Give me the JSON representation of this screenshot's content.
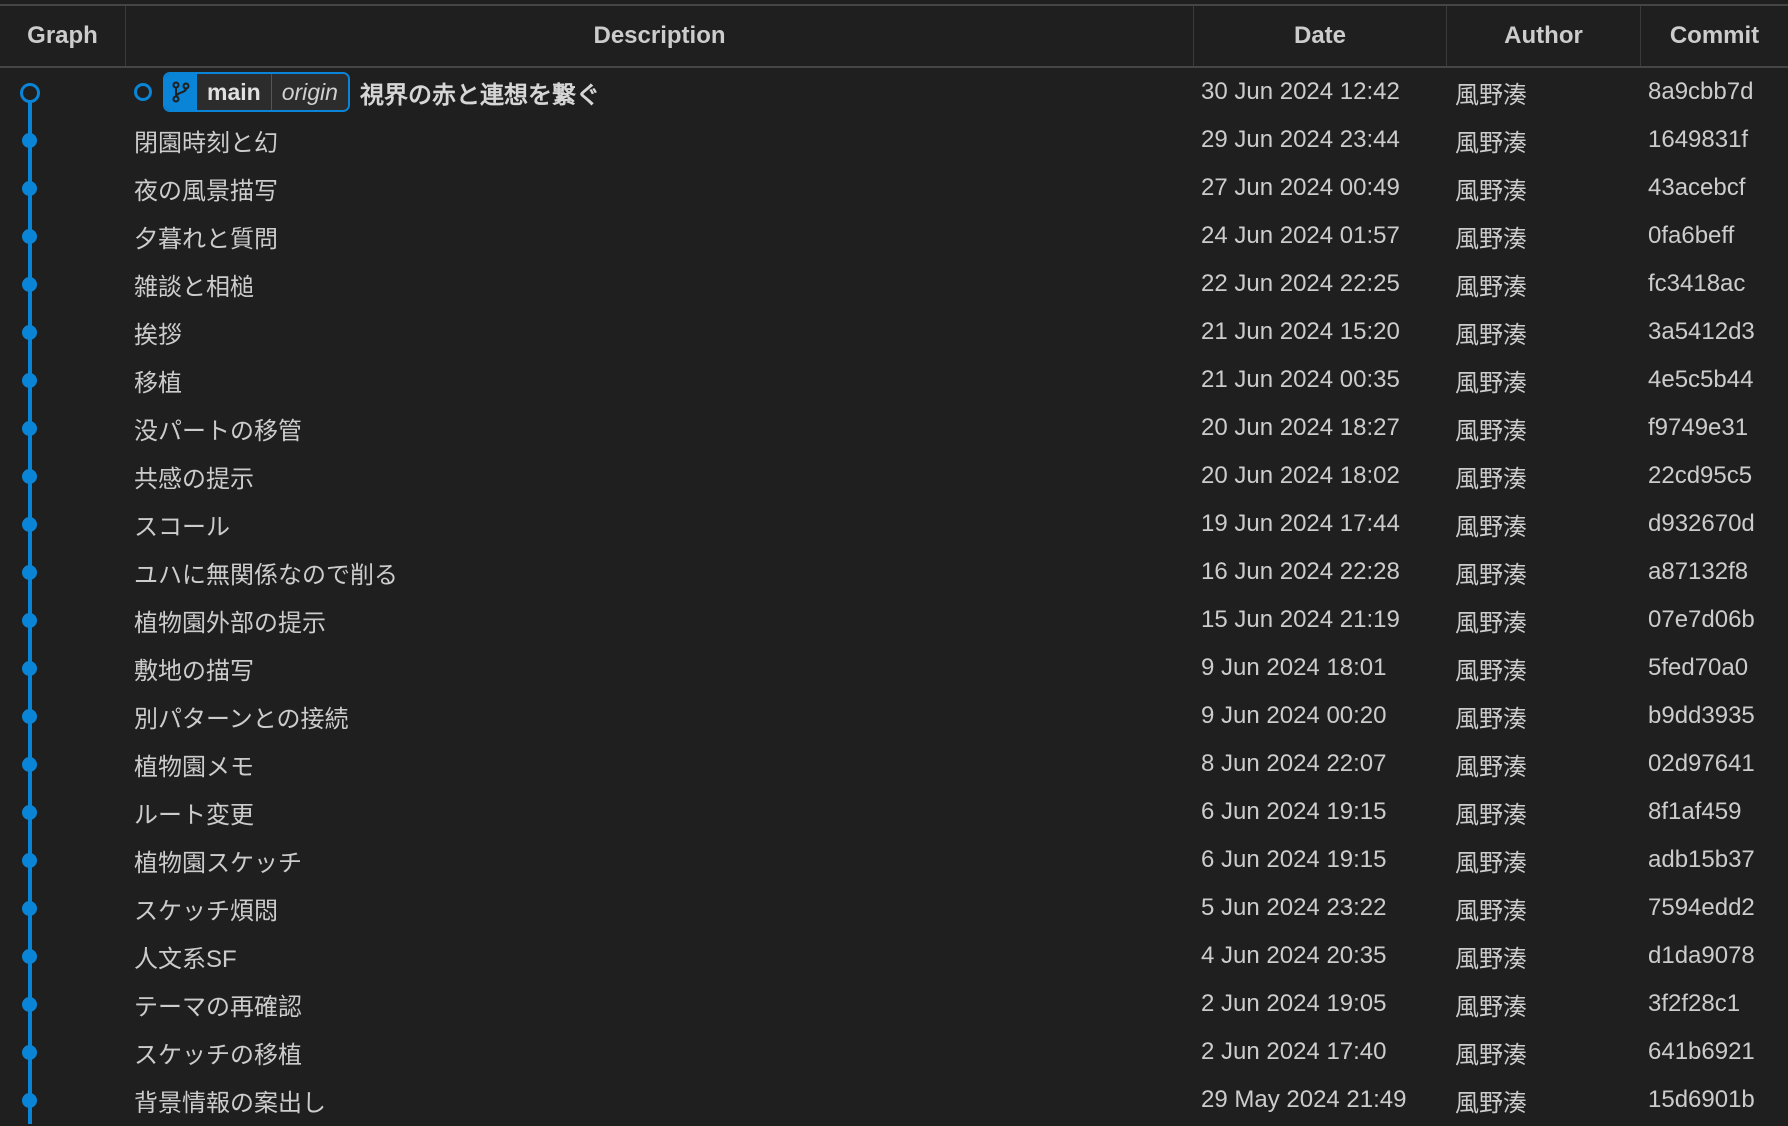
{
  "columns": {
    "graph": "Graph",
    "description": "Description",
    "date": "Date",
    "author": "Author",
    "commit": "Commit"
  },
  "colors": {
    "accent": "#0a84d6",
    "background": "#1f1f1f",
    "text": "#cccccc"
  },
  "head_refs": {
    "icon": "git-branch-icon",
    "branch": "main",
    "remote": "origin"
  },
  "commits": [
    {
      "description": "視界の赤と連想を繋ぐ",
      "date": "30 Jun 2024 12:42",
      "author": "風野湊",
      "commit": "8a9cbb7d"
    },
    {
      "description": "閉園時刻と幻",
      "date": "29 Jun 2024 23:44",
      "author": "風野湊",
      "commit": "1649831f"
    },
    {
      "description": "夜の風景描写",
      "date": "27 Jun 2024 00:49",
      "author": "風野湊",
      "commit": "43acebcf"
    },
    {
      "description": "夕暮れと質問",
      "date": "24 Jun 2024 01:57",
      "author": "風野湊",
      "commit": "0fa6beff"
    },
    {
      "description": "雑談と相槌",
      "date": "22 Jun 2024 22:25",
      "author": "風野湊",
      "commit": "fc3418ac"
    },
    {
      "description": "挨拶",
      "date": "21 Jun 2024 15:20",
      "author": "風野湊",
      "commit": "3a5412d3"
    },
    {
      "description": "移植",
      "date": "21 Jun 2024 00:35",
      "author": "風野湊",
      "commit": "4e5c5b44"
    },
    {
      "description": "没パートの移管",
      "date": "20 Jun 2024 18:27",
      "author": "風野湊",
      "commit": "f9749e31"
    },
    {
      "description": "共感の提示",
      "date": "20 Jun 2024 18:02",
      "author": "風野湊",
      "commit": "22cd95c5"
    },
    {
      "description": "スコール",
      "date": "19 Jun 2024 17:44",
      "author": "風野湊",
      "commit": "d932670d"
    },
    {
      "description": "ユハに無関係なので削る",
      "date": "16 Jun 2024 22:28",
      "author": "風野湊",
      "commit": "a87132f8"
    },
    {
      "description": "植物園外部の提示",
      "date": "15 Jun 2024 21:19",
      "author": "風野湊",
      "commit": "07e7d06b"
    },
    {
      "description": "敷地の描写",
      "date": "9 Jun 2024 18:01",
      "author": "風野湊",
      "commit": "5fed70a0"
    },
    {
      "description": "別パターンとの接続",
      "date": "9 Jun 2024 00:20",
      "author": "風野湊",
      "commit": "b9dd3935"
    },
    {
      "description": "植物園メモ",
      "date": "8 Jun 2024 22:07",
      "author": "風野湊",
      "commit": "02d97641"
    },
    {
      "description": "ルート変更",
      "date": "6 Jun 2024 19:15",
      "author": "風野湊",
      "commit": "8f1af459"
    },
    {
      "description": "植物園スケッチ",
      "date": "6 Jun 2024 19:15",
      "author": "風野湊",
      "commit": "adb15b37"
    },
    {
      "description": "スケッチ煩悶",
      "date": "5 Jun 2024 23:22",
      "author": "風野湊",
      "commit": "7594edd2"
    },
    {
      "description": "人文系SF",
      "date": "4 Jun 2024 20:35",
      "author": "風野湊",
      "commit": "d1da9078"
    },
    {
      "description": "テーマの再確認",
      "date": "2 Jun 2024 19:05",
      "author": "風野湊",
      "commit": "3f2f28c1"
    },
    {
      "description": "スケッチの移植",
      "date": "2 Jun 2024 17:40",
      "author": "風野湊",
      "commit": "641b6921"
    },
    {
      "description": "背景情報の案出し",
      "date": "29 May 2024 21:49",
      "author": "風野湊",
      "commit": "15d6901b"
    }
  ]
}
